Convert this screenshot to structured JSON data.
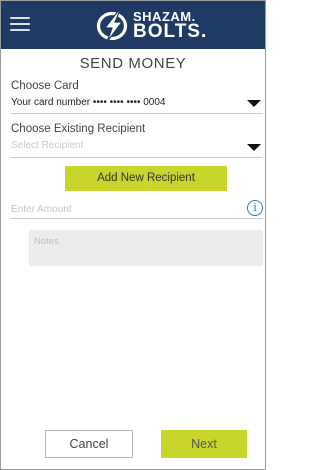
{
  "header": {
    "logo_top": "SHAZAM.",
    "logo_bottom": "BOLTS.",
    "menu_icon": "hamburger-icon",
    "logo_icon": "lightning-bolt-icon",
    "background_color": "#1f3a63"
  },
  "page": {
    "title": "SEND MONEY"
  },
  "form": {
    "card_label": "Choose Card",
    "card_value": "Your card number •••• •••• •••• 0004",
    "recipient_label": "Choose Existing Recipient",
    "recipient_placeholder": "Select Recipient",
    "add_recipient_label": "Add New Recipient",
    "amount_placeholder": "Enter Amount",
    "amount_info_icon": "info-icon",
    "notes_placeholder": "Notes",
    "dropdown_icon": "caret-down-icon"
  },
  "footer": {
    "cancel_label": "Cancel",
    "next_label": "Next"
  },
  "colors": {
    "accent": "#c8d62b",
    "info": "#3a76c4"
  }
}
